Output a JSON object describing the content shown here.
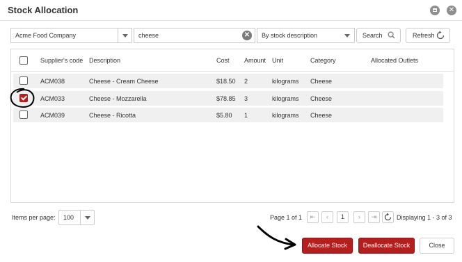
{
  "window": {
    "title": "Stock Allocation"
  },
  "filters": {
    "supplier": "Acme Food Company",
    "search_value": "cheese",
    "search_mode": "By stock description",
    "search_label": "Search",
    "refresh_label": "Refresh"
  },
  "table": {
    "columns": [
      "Supplier's code",
      "Description",
      "Cost",
      "Amount",
      "Unit",
      "Category",
      "Allocated Outlets"
    ],
    "rows": [
      {
        "code": "ACM038",
        "description": "Cheese - Cream Cheese",
        "cost": "$18.50",
        "amount": "2",
        "unit": "kilograms",
        "category": "Cheese",
        "outlets": "",
        "checked": false
      },
      {
        "code": "ACM033",
        "description": "Cheese - Mozzarella",
        "cost": "$78.85",
        "amount": "3",
        "unit": "kilograms",
        "category": "Cheese",
        "outlets": "",
        "checked": true
      },
      {
        "code": "ACM039",
        "description": "Cheese - Ricotta",
        "cost": "$5.80",
        "amount": "1",
        "unit": "kilograms",
        "category": "Cheese",
        "outlets": "",
        "checked": false
      }
    ]
  },
  "pager": {
    "items_per_page_label": "Items per page:",
    "items_per_page": "100",
    "page_info": "Page 1 of 1",
    "current_page": "1",
    "displaying": "Displaying 1 - 3 of 3"
  },
  "actions": {
    "allocate": "Allocate Stock",
    "deallocate": "Deallocate Stock",
    "close": "Close"
  },
  "colors": {
    "accent": "#b31e1e",
    "row_bg": "#f0f0f0"
  },
  "icons": [
    "window-maximize-icon",
    "window-close-icon",
    "clear-search-icon",
    "chevron-down-icon",
    "search-icon",
    "refresh-icon",
    "first-page-icon",
    "prev-page-icon",
    "next-page-icon",
    "last-page-icon",
    "refresh-icon"
  ]
}
